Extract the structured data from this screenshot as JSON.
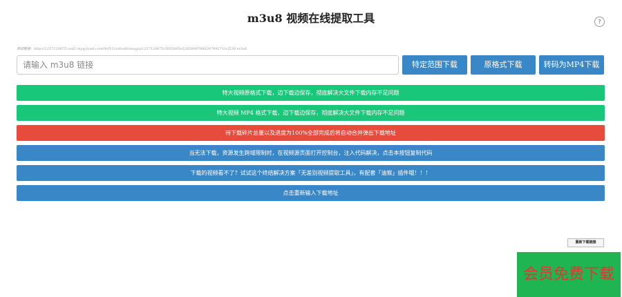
{
  "header": {
    "title": "m3u8 视频在线提取工具",
    "help_icon_text": "?"
  },
  "test_link": "测试链接：http://1257120875.vod2.myqcloud.com/0ef121cdvodtransgzp1257120875/3055695e5285890780828799271/v.f230.m3u8",
  "search": {
    "placeholder": "请输入 m3u8 链接",
    "value": ""
  },
  "buttons": {
    "range_download": "特定范围下载",
    "original_download": "原格式下载",
    "transcode_mp4": "转码为MP4下载"
  },
  "bars": [
    {
      "label": "特大视频原格式下载，边下载边保存，彻底解决大文件下载内存不足问题",
      "color": "#19c77a"
    },
    {
      "label": "特大视频 MP4 格式下载，边下载边保存，彻底解决大文件下载内存不足问题",
      "color": "#19c77a"
    },
    {
      "label": "待下载碎片总量以及进度为100%全部完成后将自动合并弹出下载地址",
      "color": "#e64b3b"
    },
    {
      "label": "当无法下载，资源发生跨域限制时，在视频源页面打开控制台，注入代码解决，点击本按钮复制代码",
      "color": "#3a87c8"
    },
    {
      "label": "下载的视频看不了？试试这个终结解决方案「无差别视频提取工具」，有配套「油猴」插件哦！！！",
      "color": "#3a87c8"
    },
    {
      "label": "点击重新输入下载地址",
      "color": "#3a87c8"
    }
  ],
  "redownload_label": "重新下载链接",
  "vip_banner": "会员免费下载"
}
